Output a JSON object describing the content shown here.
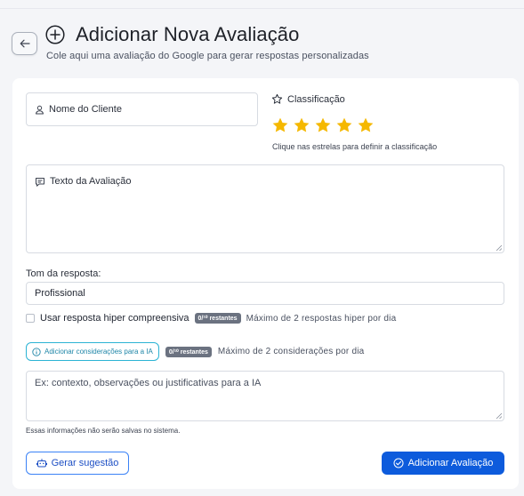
{
  "header": {
    "title": "Adicionar Nova Avaliação",
    "subtitle": "Cole aqui uma avaliação do Google para gerar respostas personalizadas",
    "back_icon": "arrow-left-icon",
    "title_icon": "plus-circle-icon"
  },
  "form": {
    "client_name_placeholder": "Nome do Cliente",
    "rating": {
      "label": "Classificação",
      "value": 5,
      "max": 5,
      "hint": "Clique nas estrelas para definir a classificação",
      "star_color": "#f5b800"
    },
    "review_placeholder": "Texto da Avaliação",
    "tone": {
      "label": "Tom da resposta:",
      "selected": "Profissional"
    },
    "hyper": {
      "label": "Usar resposta hiper compreensiva",
      "checked": false,
      "badge": "0/¹⁰ restantes",
      "limit_text": "Máximo de 2 respostas hiper por dia"
    },
    "considerations": {
      "button_label": "Adicionar considerações para a IA",
      "badge": "0/¹⁰ restantes",
      "limit_text": "Máximo de 2 considerações por dia"
    },
    "context_placeholder": "Ex: contexto, observações ou justificativas para a IA",
    "note": "Essas informações não serão salvas no sistema."
  },
  "actions": {
    "suggest_label": "Gerar sugestão",
    "add_label": "Adicionar Avaliação"
  },
  "colors": {
    "primary": "#0d5bdc",
    "info": "#2bb3d4",
    "badge_bg": "#6b7280"
  }
}
